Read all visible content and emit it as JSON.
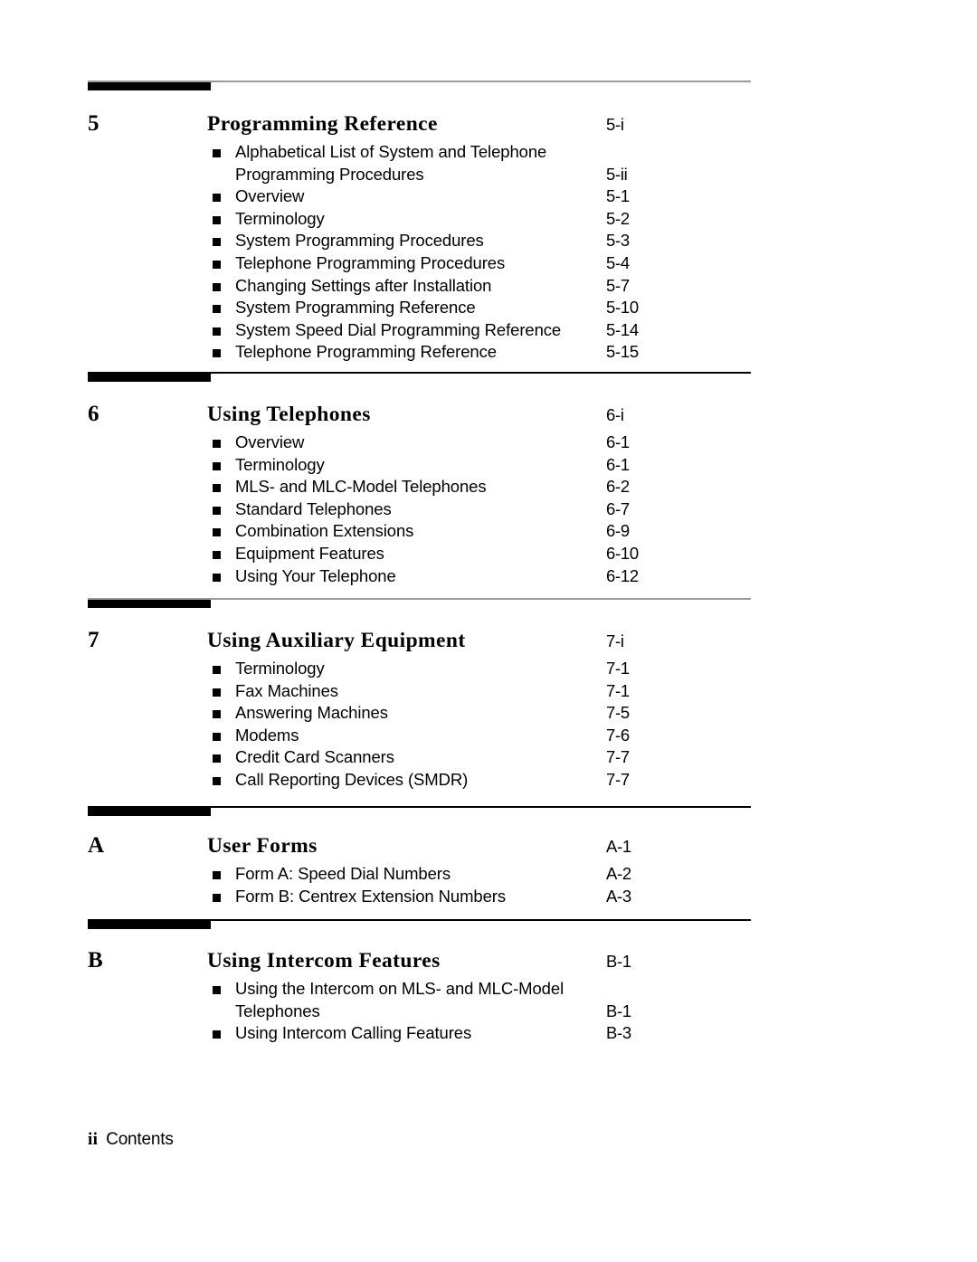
{
  "document": {
    "kind": "table-of-contents",
    "footer": {
      "folio": "ii",
      "label": "Contents"
    }
  },
  "sections": [
    {
      "rule_color": "#9a9a9a",
      "number": "5",
      "title": "Programming Reference",
      "page": "5-i",
      "entries": [
        {
          "text": "Alphabetical List of System and Telephone",
          "text2": "Programming Procedures",
          "page": "5-ii"
        },
        {
          "text": "Overview",
          "page": "5-1"
        },
        {
          "text": "Terminology",
          "page": "5-2"
        },
        {
          "text": "System Programming Procedures",
          "page": "5-3"
        },
        {
          "text": "Telephone Programming Procedures",
          "page": "5-4"
        },
        {
          "text": "Changing Settings after Installation",
          "page": "5-7"
        },
        {
          "text": "System Programming Reference",
          "page": "5-10"
        },
        {
          "text": "System Speed Dial Programming Reference",
          "page": "5-14"
        },
        {
          "text": "Telephone Programming Reference",
          "page": "5-15"
        }
      ]
    },
    {
      "rule_color": "#000000",
      "number": "6",
      "title": "Using Telephones",
      "page": "6-i",
      "entries": [
        {
          "text": "Overview",
          "page": "6-1"
        },
        {
          "text": "Terminology",
          "page": "6-1"
        },
        {
          "text": "MLS- and MLC-Model Telephones",
          "page": "6-2"
        },
        {
          "text": "Standard  Telephones",
          "page": "6-7"
        },
        {
          "text": "Combination Extensions",
          "page": "6-9"
        },
        {
          "text": "Equipment  Features",
          "page": "6-10"
        },
        {
          "text": "Using Your Telephone",
          "page": "6-12"
        }
      ]
    },
    {
      "rule_color": "#9a9a9a",
      "number": "7",
      "title": "Using Auxiliary Equipment",
      "page": "7-i",
      "entries": [
        {
          "text": "Terminology",
          "page": "7-1"
        },
        {
          "text": "Fax  Machines",
          "page": "7-1"
        },
        {
          "text": "Answering Machines",
          "page": "7-5"
        },
        {
          "text": "Modems",
          "page": "7-6"
        },
        {
          "text": "Credit Card Scanners",
          "page": "7-7"
        },
        {
          "text": "Call  Reporting  Devices  (SMDR)",
          "page": "7-7"
        }
      ]
    },
    {
      "rule_color": "#000000",
      "number": "A",
      "title": "User Forms",
      "page": "A-1",
      "entries": [
        {
          "text": "Form A: Speed Dial Numbers",
          "page": "A-2"
        },
        {
          "text": "Form B: Centrex Extension Numbers",
          "page": "A-3"
        }
      ]
    },
    {
      "rule_color": "#000000",
      "number": "B",
      "title": "Using Intercom Features",
      "page": "B-1",
      "entries": [
        {
          "text": "Using the Intercom on MLS- and MLC-Model",
          "text2": "Telephones",
          "page": "B-1"
        },
        {
          "text": "Using Intercom Calling Features",
          "page": "B-3"
        }
      ]
    }
  ]
}
